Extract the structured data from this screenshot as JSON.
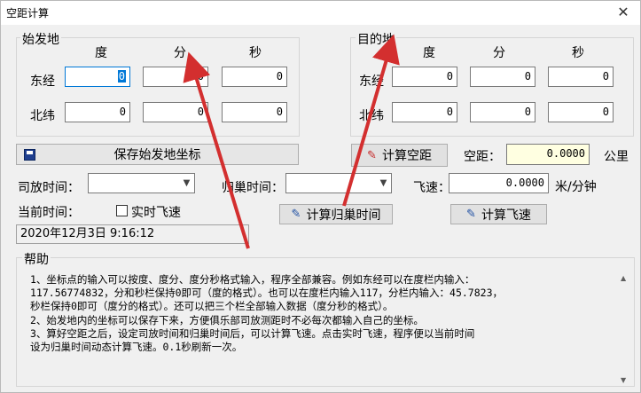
{
  "window": {
    "title": "空距计算",
    "close_label": "✕"
  },
  "origin": {
    "group_title": "始发地",
    "col_deg": "度",
    "col_min": "分",
    "col_sec": "秒",
    "row_east": "东经",
    "row_north": "北纬",
    "east_deg": "0",
    "east_min": "0",
    "east_sec": "0",
    "north_deg": "0",
    "north_min": "0",
    "north_sec": "0"
  },
  "dest": {
    "group_title": "目的地",
    "col_deg": "度",
    "col_min": "分",
    "col_sec": "秒",
    "row_east": "东经",
    "row_north": "北纬",
    "east_deg": "0",
    "east_min": "0",
    "east_sec": "0",
    "north_deg": "0",
    "north_min": "0",
    "north_sec": "0"
  },
  "buttons": {
    "save_origin": "保存始发地坐标",
    "calc_distance": "计算空距",
    "calc_return_time": "计算归巢时间",
    "calc_speed": "计算飞速"
  },
  "distance": {
    "label": "空距：",
    "value": "0.0000",
    "unit": "公里"
  },
  "release_time": {
    "label": "司放时间："
  },
  "return_time": {
    "label": "归巢时间："
  },
  "speed": {
    "label": "飞速：",
    "value": "0.0000",
    "unit": "米/分钟"
  },
  "current_time": {
    "label": "当前时间：",
    "realtime_label": "实时飞速",
    "value": "2020年12月3日  9:16:12"
  },
  "help": {
    "title": "帮助",
    "text": "1、坐标点的输入可以按度、度分、度分秒格式输入，程序全部兼容。例如东经可以在度栏内输入：\n117.56774832，分和秒栏保持0即可（度的格式）。也可以在度栏内输入117，分栏内输入：45.7823，\n秒栏保持0即可（度分的格式）。还可以把三个栏全部输入数据（度分秒的格式）。\n2、始发地内的坐标可以保存下来，方便俱乐部司放测距时不必每次都输入自己的坐标。\n3、算好空距之后，设定司放时间和归巢时间后，可以计算飞速。点击实时飞速，程序便以当前时间\n设为归巢时间动态计算飞速。0.1秒刷新一次。"
  },
  "colors": {
    "annotation_arrow": "#d32f2f",
    "highlight_field": "#ffffe1",
    "focus_blue": "#0078d7"
  }
}
